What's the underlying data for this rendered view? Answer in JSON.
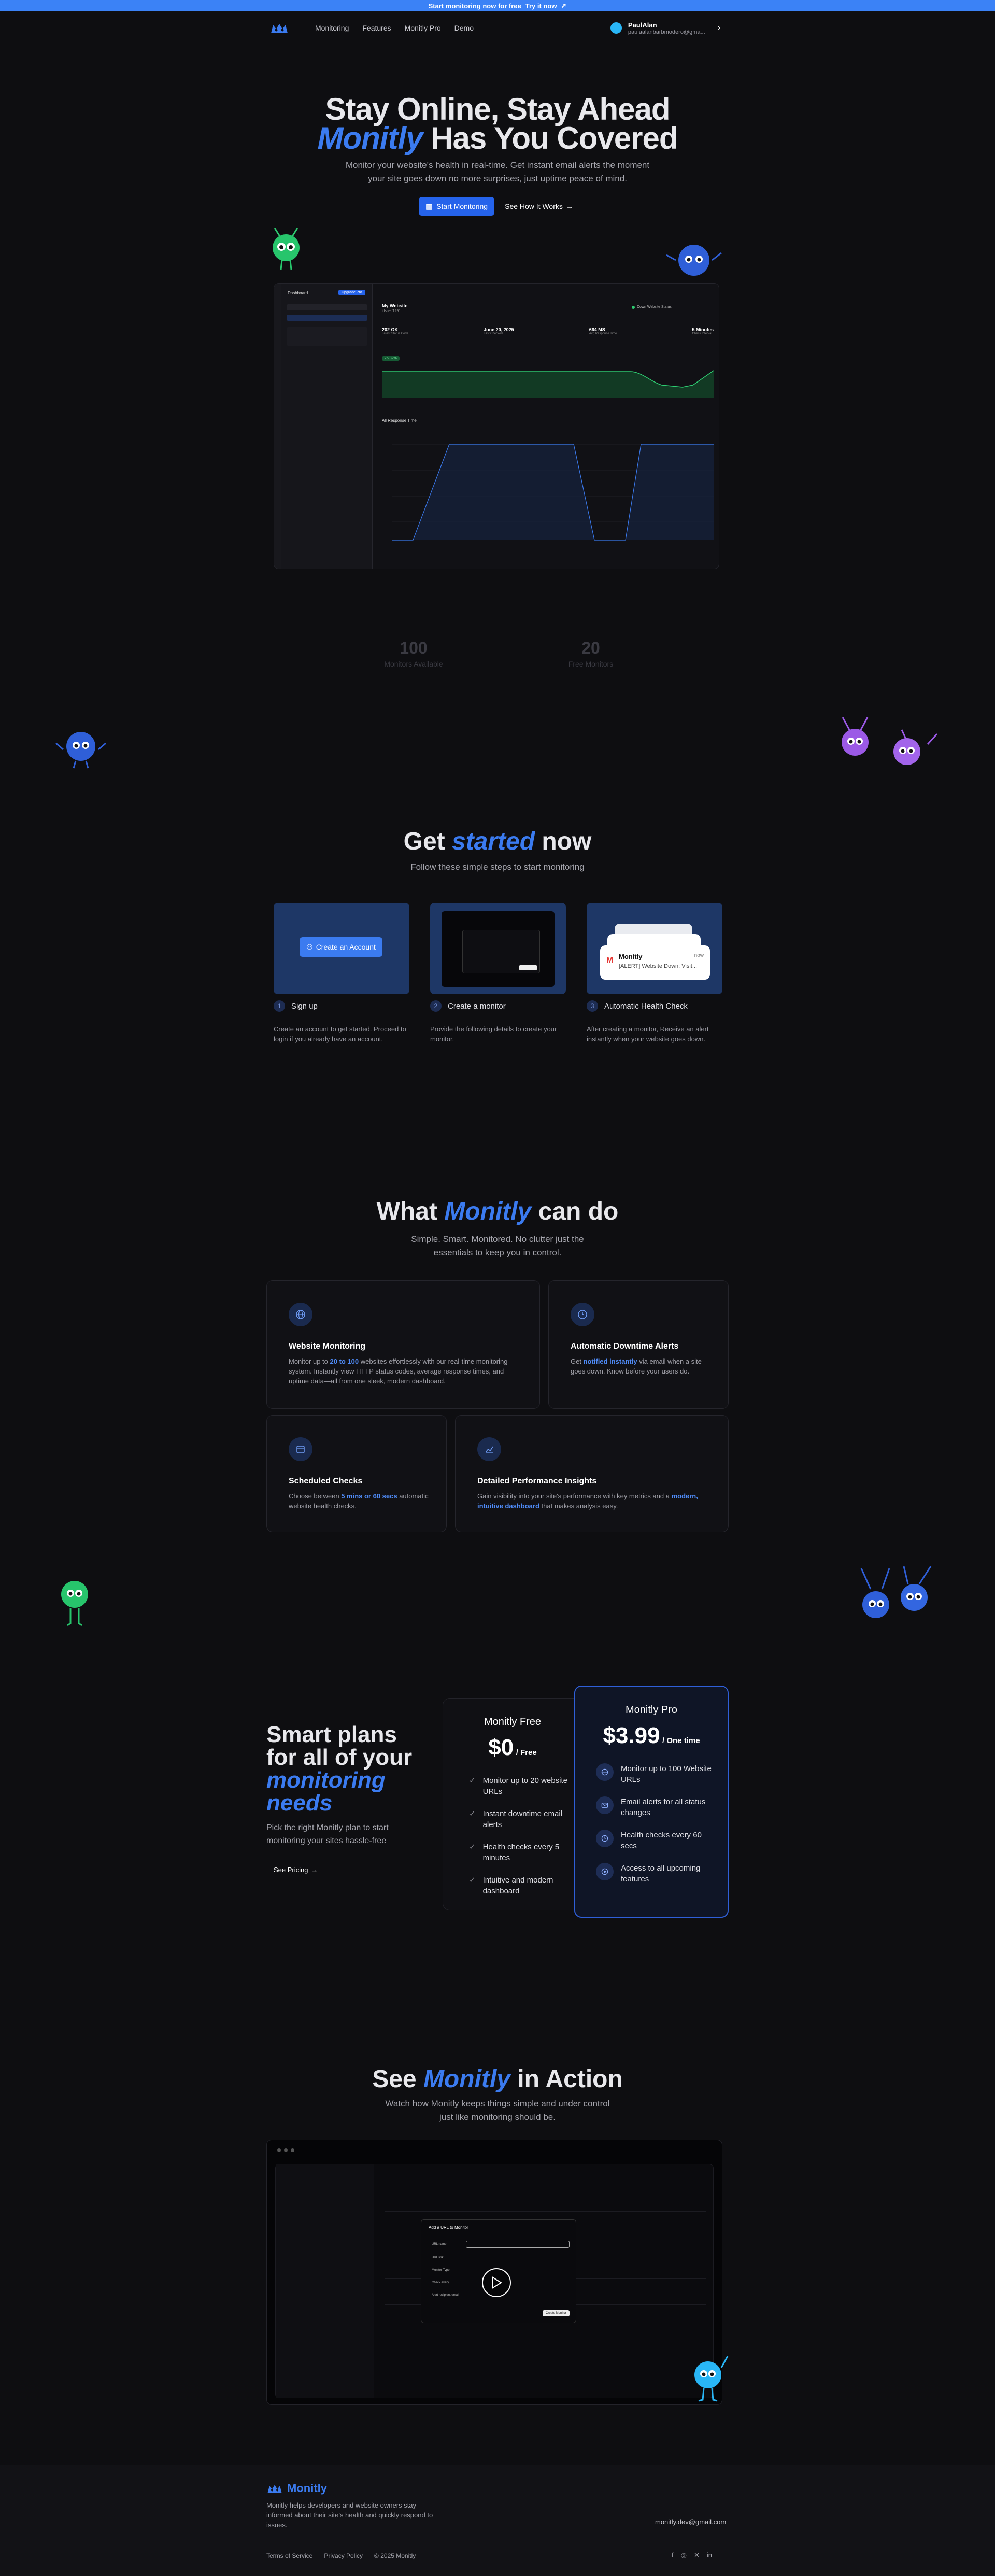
{
  "banner": {
    "text": "Start monitoring now for free",
    "cta": "Try it now",
    "icon": "rocket-icon"
  },
  "nav": {
    "links": [
      "Monitoring",
      "Features",
      "Monitly Pro",
      "Demo"
    ],
    "user_name": "PaulAlan",
    "user_email": "paulaalanbarbmodero@gma..."
  },
  "hero": {
    "line1": "Stay Online, Stay Ahead",
    "brand": "Monitly",
    "line2_rest": "Has You Covered",
    "subtitle": "Monitor your website's health in real-time. Get instant email alerts the moment your site goes down no more surprises, just uptime peace of mind.",
    "primary_cta": "Start Monitoring",
    "secondary_cta": "See How It Works"
  },
  "dashboard": {
    "sidebar_title": "Dashboard",
    "upgrade_label": "Upgrade Pro",
    "site_name": "My Website",
    "site_url": "ldsnet/1291",
    "status_label": "Down Website Status",
    "metrics": [
      {
        "value": "202 OK",
        "label": "Latest Status Code"
      },
      {
        "value": "June 20, 2025",
        "label": "Last Checked"
      },
      {
        "value": "664 MS",
        "label": "Avg Response Time"
      },
      {
        "value": "5 Minutes",
        "label": "Check Interval"
      }
    ],
    "uptime_badge": "76.32%",
    "chart_title": "All Response Time"
  },
  "stats": [
    {
      "value": "100",
      "label": "Monitors Available"
    },
    {
      "value": "20",
      "label": "Free Monitors"
    }
  ],
  "get_started": {
    "title_a": "Get",
    "title_em": "started",
    "title_b": "now",
    "subtitle": "Follow these simple steps to start monitoring",
    "create_btn": "Create an Account",
    "steps": [
      {
        "num": "1",
        "title": "Sign up",
        "desc": "Create an account to get started. Proceed to login if you already have an account."
      },
      {
        "num": "2",
        "title": "Create a monitor",
        "desc": "Provide the following details to create your monitor."
      },
      {
        "num": "3",
        "title": "Automatic Health Check",
        "desc": "After creating a monitor, Receive an alert instantly when your website goes down."
      }
    ],
    "alert_brand": "Monitly",
    "alert_text": "[ALERT] Website Down: Visit...",
    "alert_time": "now"
  },
  "features": {
    "title_a": "What",
    "title_em": "Monitly",
    "title_b": "can do",
    "subtitle": "Simple. Smart. Monitored. No clutter just the essentials to keep you in control.",
    "items": [
      {
        "title": "Website Monitoring",
        "d1": "Monitor up to ",
        "hl": "20 to 100",
        "d2": " websites effortlessly with our real-time monitoring system. Instantly view HTTP status codes, average response times, and uptime data—all from one sleek, modern dashboard.",
        "icon": "globe-icon"
      },
      {
        "title": "Automatic Downtime Alerts",
        "d1": "Get ",
        "hl": "notified instantly",
        "d2": " via email when a site goes down. Know before your users do.",
        "icon": "clock-icon"
      },
      {
        "title": "Scheduled Checks",
        "d1": "Choose between ",
        "hl": "5 mins or 60 secs",
        "d2": " automatic website health checks.",
        "icon": "calendar-icon"
      },
      {
        "title": "Detailed Performance Insights",
        "d1": "Gain visibility into your site's performance with key metrics and a ",
        "hl": "modern, intuitive dashboard",
        "d2": " that makes analysis easy.",
        "icon": "chart-icon"
      }
    ]
  },
  "plans": {
    "line1": "Smart plans",
    "line2": "for all of your",
    "line3": "monitoring",
    "line4": "needs",
    "subtitle": "Pick the right Monitly plan to start monitoring your sites hassle-free",
    "link": "See Pricing",
    "free": {
      "name": "Monitly Free",
      "price": "$0",
      "unit": "/ Free",
      "features": [
        "Monitor up to 20 website URLs",
        "Instant downtime email alerts",
        "Health checks every 5 minutes",
        "Intuitive and modern dashboard"
      ]
    },
    "pro": {
      "name": "Monitly Pro",
      "price": "$3.99",
      "unit": "/ One time",
      "features": [
        "Monitor up to 100 Website URLs",
        "Email alerts for all status changes",
        "Health checks every 60 secs",
        "Access to all upcoming features"
      ]
    }
  },
  "demo": {
    "title_a": "See",
    "title_em": "Monitly",
    "title_b": "in Action",
    "subtitle": "Watch how Monitly keeps things simple and under control just like monitoring should be.",
    "modal_title": "Add a URL to Monitor",
    "fields": [
      "URL name",
      "URL link",
      "Monitor Type",
      "Check every",
      "Alert recipient email"
    ],
    "submit": "Create Monitor"
  },
  "footer": {
    "brand": "Monitly",
    "desc": "Monitly helps developers and website owners stay informed about their site's health and quickly respond to issues.",
    "email": "monitly.dev@gmail.com",
    "links": [
      "Terms of Service",
      "Privacy Policy",
      "© 2025 Monitly"
    ],
    "social": [
      "facebook-icon",
      "instagram-icon",
      "twitter-icon",
      "linkedin-icon"
    ]
  },
  "colors": {
    "accent": "#3b7bf0",
    "bg": "#0e0e11",
    "card_blue": "#1e3766",
    "mascot_green": "#2ecc71",
    "mascot_blue": "#2f5fd8",
    "mascot_purple": "#9b59e6"
  }
}
